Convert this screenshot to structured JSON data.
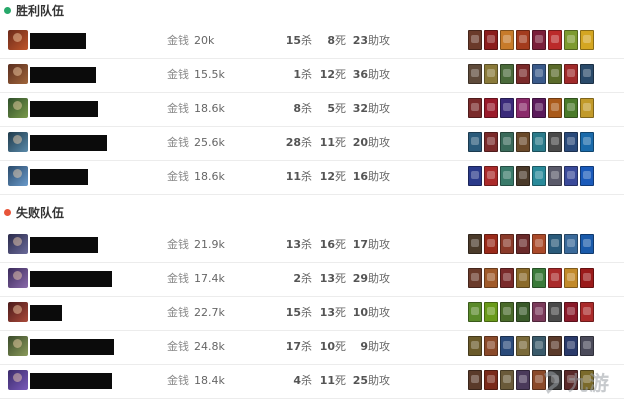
{
  "winning_team": {
    "title": "胜利队伍",
    "color": "#27a86a",
    "players": [
      {
        "gold_label": "金钱",
        "gold": "20k",
        "kills": "15",
        "kills_unit": "杀",
        "deaths": "8",
        "deaths_unit": "死",
        "assists": "23",
        "assists_unit": "助攻",
        "name_redacted": true,
        "avatar_colors": [
          "#6b2a1a",
          "#c0562b"
        ],
        "item_colors": [
          "#6a3a2a",
          "#8b1d1d",
          "#c77b2a",
          "#a33b1d",
          "#7a1f3a",
          "#bb2a2a",
          "#7d9a2f",
          "#d4a622"
        ]
      },
      {
        "gold_label": "金钱",
        "gold": "15.5k",
        "kills": "1",
        "kills_unit": "杀",
        "deaths": "12",
        "deaths_unit": "死",
        "assists": "36",
        "assists_unit": "助攻",
        "name_redacted": true,
        "avatar_colors": [
          "#5a2e1f",
          "#a0653a"
        ],
        "item_colors": [
          "#5e4a3a",
          "#8a7a3a",
          "#4a6a3a",
          "#7a2a2a",
          "#3a5a8a",
          "#5a6a2a",
          "#a02a2a",
          "#2a4a6a"
        ]
      },
      {
        "gold_label": "金钱",
        "gold": "18.6k",
        "kills": "8",
        "kills_unit": "杀",
        "deaths": "5",
        "deaths_unit": "死",
        "assists": "32",
        "assists_unit": "助攻",
        "name_redacted": true,
        "avatar_colors": [
          "#2f4f2a",
          "#7a9a4a"
        ],
        "item_colors": [
          "#7a2a2a",
          "#9a1a2a",
          "#3a2a7a",
          "#8a2a6a",
          "#5a1a5a",
          "#aa5a1a",
          "#4a7a2a",
          "#c29a2a"
        ]
      },
      {
        "gold_label": "金钱",
        "gold": "25.6k",
        "kills": "28",
        "kills_unit": "杀",
        "deaths": "11",
        "deaths_unit": "死",
        "assists": "20",
        "assists_unit": "助攻",
        "name_redacted": true,
        "avatar_colors": [
          "#1f3a4a",
          "#5a8aaa"
        ],
        "item_colors": [
          "#2a5a7a",
          "#7a2a2a",
          "#3a6a5a",
          "#6a4a2a",
          "#2a7a8a",
          "#4a4a4a",
          "#2a4a7a",
          "#1a6aaa"
        ]
      },
      {
        "gold_label": "金钱",
        "gold": "18.6k",
        "kills": "11",
        "kills_unit": "杀",
        "deaths": "12",
        "deaths_unit": "死",
        "assists": "16",
        "assists_unit": "助攻",
        "name_redacted": true,
        "avatar_colors": [
          "#2a4a6a",
          "#6a9aca"
        ],
        "item_colors": [
          "#2a3a8a",
          "#aa2a2a",
          "#3a7a6a",
          "#4a3a2a",
          "#2a8a9a",
          "#5a5a6a",
          "#3a4a9a",
          "#1a5aba"
        ]
      }
    ]
  },
  "losing_team": {
    "title": "失败队伍",
    "color": "#e8553a",
    "players": [
      {
        "gold_label": "金钱",
        "gold": "21.9k",
        "kills": "13",
        "kills_unit": "杀",
        "deaths": "16",
        "deaths_unit": "死",
        "assists": "17",
        "assists_unit": "助攻",
        "name_redacted": true,
        "avatar_colors": [
          "#2a2a4a",
          "#6a6a9a"
        ],
        "item_colors": [
          "#4a3a2a",
          "#9a2a1a",
          "#8a3a2a",
          "#6a2a2a",
          "#aa4a2a",
          "#2a5a7a",
          "#3a6a9a",
          "#1a5aaa"
        ]
      },
      {
        "gold_label": "金钱",
        "gold": "17.4k",
        "kills": "2",
        "kills_unit": "杀",
        "deaths": "13",
        "deaths_unit": "死",
        "assists": "29",
        "assists_unit": "助攻",
        "name_redacted": true,
        "avatar_colors": [
          "#3a2a5a",
          "#8a6aaa"
        ],
        "item_colors": [
          "#6a3a2a",
          "#a05a2a",
          "#7a2a2a",
          "#8a6a2a",
          "#3a7a3a",
          "#aa2a2a",
          "#c28a2a",
          "#9a1a1a"
        ]
      },
      {
        "gold_label": "金钱",
        "gold": "22.7k",
        "kills": "15",
        "kills_unit": "杀",
        "deaths": "13",
        "deaths_unit": "死",
        "assists": "10",
        "assists_unit": "助攻",
        "name_redacted": true,
        "avatar_colors": [
          "#4a1a1a",
          "#aa4a3a"
        ],
        "item_colors": [
          "#5a8a2a",
          "#6a9a1a",
          "#4a6a2a",
          "#3a5a2a",
          "#7a3a5a",
          "#4a4a4a",
          "#8a1a2a",
          "#aa2a2a"
        ]
      },
      {
        "gold_label": "金钱",
        "gold": "24.8k",
        "kills": "17",
        "kills_unit": "杀",
        "deaths": "10",
        "deaths_unit": "死",
        "assists": "9",
        "assists_unit": "助攻",
        "name_redacted": true,
        "avatar_colors": [
          "#3a4a2a",
          "#8a9a5a"
        ],
        "item_colors": [
          "#6a5a2a",
          "#8a4a2a",
          "#2a4a7a",
          "#7a6a3a",
          "#3a5a6a",
          "#5a3a2a",
          "#2a3a6a",
          "#4a4a5a"
        ]
      },
      {
        "gold_label": "金钱",
        "gold": "18.4k",
        "kills": "4",
        "kills_unit": "杀",
        "deaths": "11",
        "deaths_unit": "死",
        "assists": "25",
        "assists_unit": "助攻",
        "name_redacted": true,
        "avatar_colors": [
          "#3a2a6a",
          "#7a5aba"
        ],
        "item_colors": [
          "#5a3a2a",
          "#7a2a1a",
          "#6a5a3a",
          "#4a3a5a",
          "#8a4a2a",
          "#3a3a3a",
          "#5a2a2a",
          "#7a6a2a"
        ]
      }
    ]
  },
  "watermark": {
    "text": "九游",
    "icon": "nine-game-logo-icon"
  }
}
